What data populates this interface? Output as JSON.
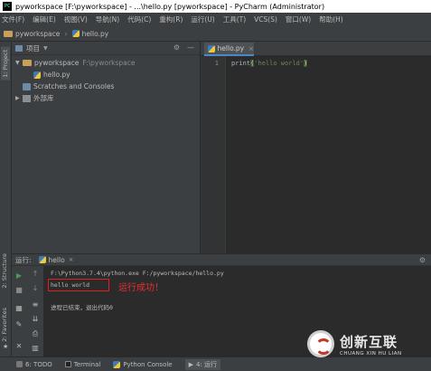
{
  "window": {
    "title": "pyworkspace [F:\\pyworkspace] - ...\\hello.py [pyworkspace] - PyCharm (Administrator)",
    "logo": "PC"
  },
  "menu": [
    "文件(F)",
    "编辑(E)",
    "视图(V)",
    "导航(N)",
    "代码(C)",
    "重构(R)",
    "运行(U)",
    "工具(T)",
    "VCS(S)",
    "窗口(W)",
    "帮助(H)"
  ],
  "navbar": {
    "project": "pyworkspace",
    "file": "hello.py"
  },
  "left_stripe": {
    "project_tab": "1: Project",
    "structure_tab": "2: Structure",
    "favorites_tab": "2: Favorites"
  },
  "project_panel": {
    "title": "项目",
    "tree": [
      {
        "label": "pyworkspace",
        "hint": "F:\\pyworkspace"
      },
      {
        "label": "hello.py"
      },
      {
        "label": "Scratches and Consoles"
      },
      {
        "label": "外部库"
      }
    ]
  },
  "editor": {
    "tab_label": "hello.py",
    "line_number": "1",
    "code": {
      "fn": "print",
      "open": "(",
      "str": "'hello world'",
      "close": ")"
    }
  },
  "run_panel": {
    "label": "运行:",
    "tab": "hello",
    "lines": [
      "F:\\Python3.7.4\\python.exe F:/pyworkspace/hello.py",
      "hello world",
      "进程已结束，退出代码0"
    ],
    "annotation": "运行成功！"
  },
  "bottom_bar": {
    "todo": "6: TODO",
    "terminal": "Terminal",
    "python_console": "Python Console",
    "run": "4: 运行"
  },
  "watermark": {
    "cn": "创新互联",
    "en": "CHUANG XIN HU LIAN"
  },
  "colors": {
    "annotation": "#e83030",
    "string": "#6a8759",
    "run_green": "#499c54"
  }
}
